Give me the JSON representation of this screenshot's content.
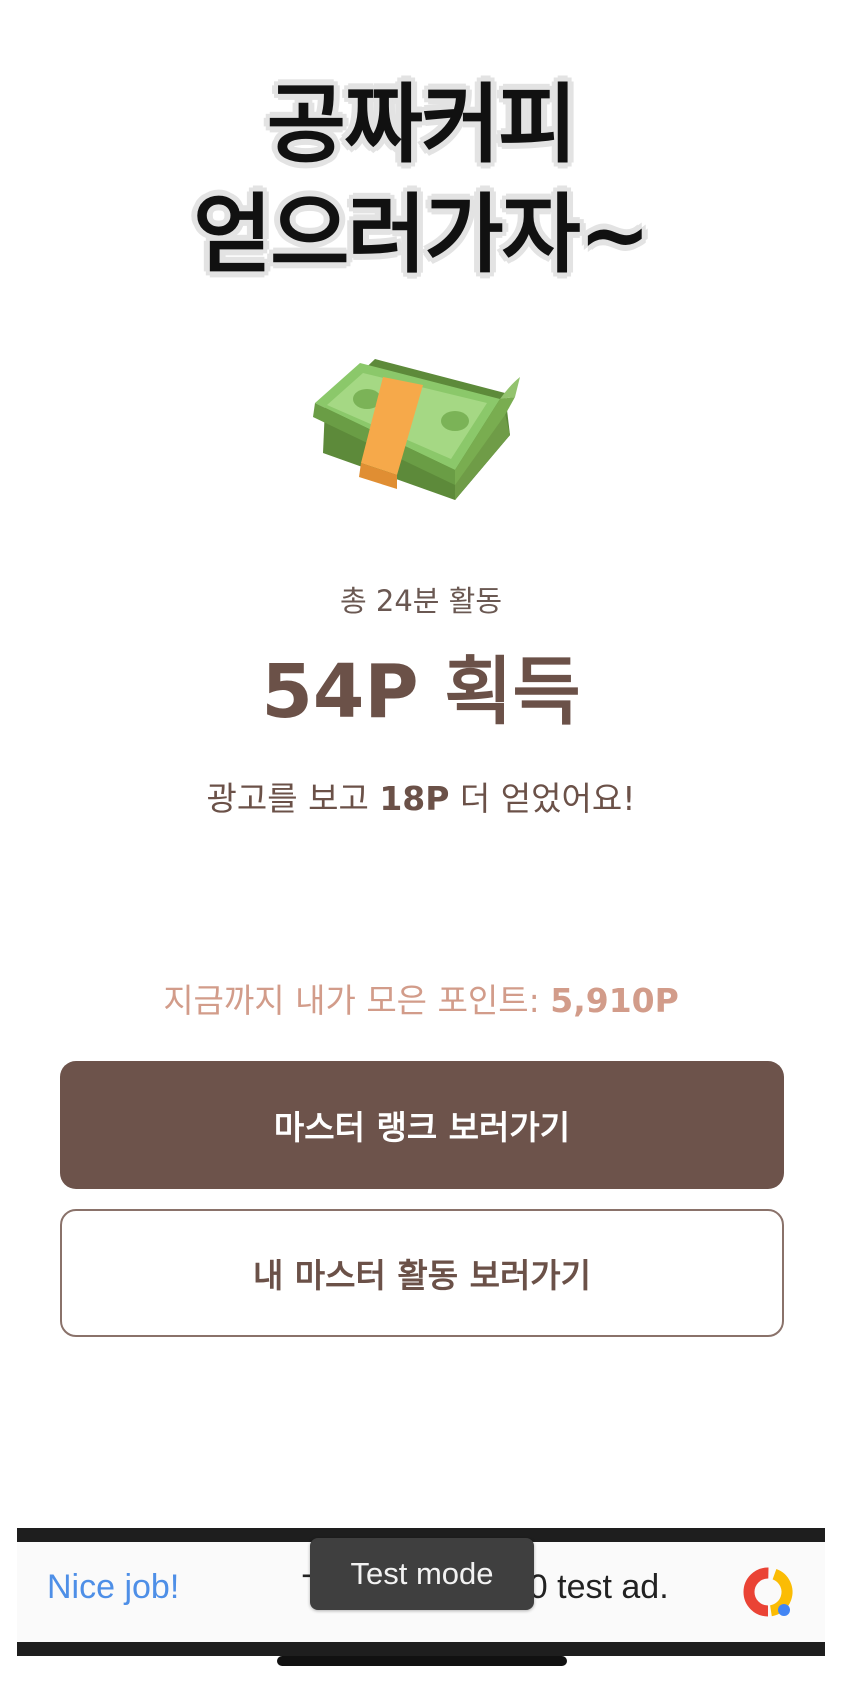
{
  "headline": {
    "line1": "공짜커피",
    "line2": "얻으러가자~"
  },
  "illustration": {
    "icon": "money-stack-icon"
  },
  "summary": {
    "total_activity": "총 24분 활동",
    "points_earned": "54P 획득",
    "ad_bonus_prefix": "광고를 보고 ",
    "ad_bonus_points": "18P",
    "ad_bonus_suffix": " 더 얻었어요!",
    "total_points_label": "지금까지 내가 모은 포인트: ",
    "total_points_value": "5,910P"
  },
  "buttons": {
    "master_rank": "마스터 랭크 보러가기",
    "my_master_activity": "내 마스터 활동 보러가기"
  },
  "ad": {
    "nice_job": "Nice job!",
    "text_visible": "T",
    "text_end": "0 test ad.",
    "test_mode": "Test mode",
    "logo_icon": "google-ads-icon"
  },
  "colors": {
    "brown_primary": "#6d534b",
    "brown_text": "#6b5148",
    "peach_text": "#d29c8a",
    "ad_blue": "#4e8fe7"
  }
}
